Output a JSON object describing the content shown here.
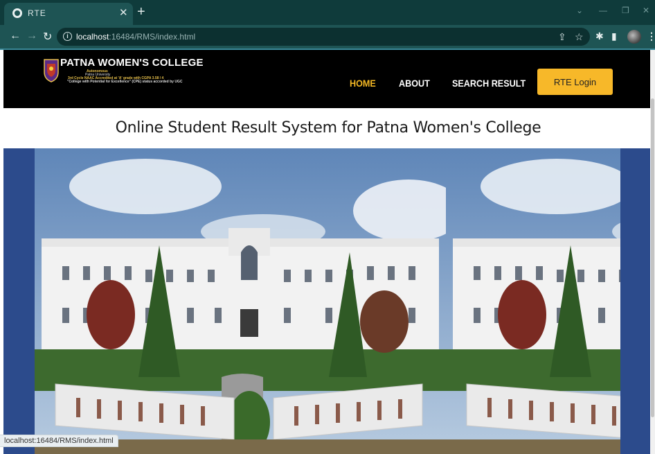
{
  "browser": {
    "tab_title": "RTE",
    "tab_close": "✕",
    "new_tab": "+",
    "url_host": "localhost",
    "url_path": ":16484/RMS/index.html",
    "window_controls": [
      "⌄",
      "—",
      "❐",
      "✕"
    ],
    "status_text": "localhost:16484/RMS/index.html"
  },
  "icons": {
    "back": "←",
    "forward": "→",
    "reload": "↻",
    "info": "i",
    "share": "⇪",
    "star": "☆",
    "extensions": "✱",
    "sidepanel": "▮",
    "menu": "⋮"
  },
  "site": {
    "college_name": "PATNA WOMEN'S COLLEGE",
    "logo_line_1": "Autonomous",
    "logo_line_2": "Patna University",
    "logo_line_3": "3rd Cycle NAAC Accredited at 'A' grade with CGPA 3.58 / 4",
    "logo_line_4": "\"College with Potential for Excellence\" (CPE) status accorded by UGC",
    "nav": [
      {
        "label": "HOME",
        "active": true
      },
      {
        "label": "ABOUT",
        "active": false
      },
      {
        "label": "SEARCH RESULT",
        "active": false
      }
    ],
    "login_button": "RTE Login",
    "heading": "Online Student Result System for Patna Women's College"
  },
  "colors": {
    "tabstrip": "#0f3b3b",
    "toolbar": "#1e5454",
    "header_bg": "#000000",
    "nav_active": "#f4b824",
    "login_bg": "#f7b829",
    "banner_bg": "#2c4b8c"
  }
}
